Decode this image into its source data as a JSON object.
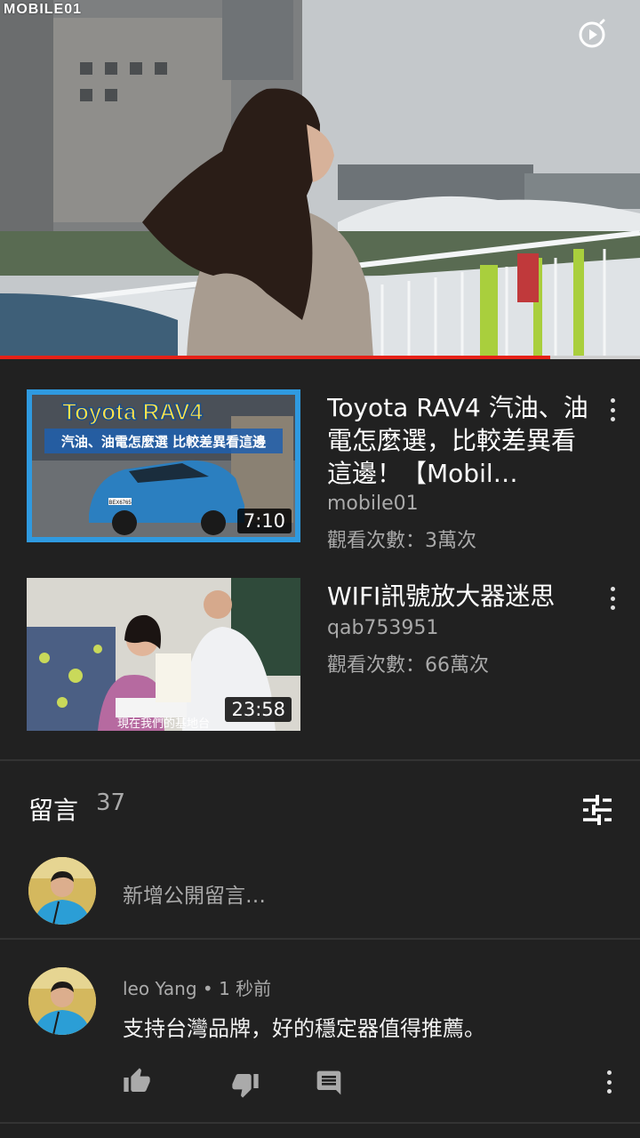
{
  "player": {
    "watermark": "MOBILE01",
    "progress_fraction": 0.86,
    "colors": {
      "progress": "#e62117",
      "track": "#cfcfcf"
    }
  },
  "related_videos": [
    {
      "thumbnail": {
        "title_line": "Toyota RAV4",
        "subtitle_line": "汽油、油電怎麼選 比較差異看這邊",
        "plate": "BEX6765"
      },
      "title": "Toyota RAV4 汽油、油電怎麼選，比較差異看這邊！【Mobil…",
      "channel": "mobile01",
      "views": "觀看次數：3萬次",
      "duration": "7:10"
    },
    {
      "thumbnail": {
        "caption": "現在我們的基地台"
      },
      "title": "WIFI訊號放大器迷思",
      "channel": "qab753951",
      "views": "觀看次數：66萬次",
      "duration": "23:58"
    }
  ],
  "comments": {
    "title": "留言",
    "count": "37",
    "add_placeholder": "新增公開留言…",
    "items": [
      {
        "author": "leo Yang",
        "time": "1 秒前",
        "text": "支持台灣品牌，好的穩定器值得推薦。"
      }
    ]
  },
  "icons": {
    "miniplayer": "miniplayer-icon",
    "more": "more-vert-icon",
    "sort": "sort-icon",
    "like": "thumb-up-icon",
    "dislike": "thumb-down-icon",
    "reply": "reply-icon"
  }
}
